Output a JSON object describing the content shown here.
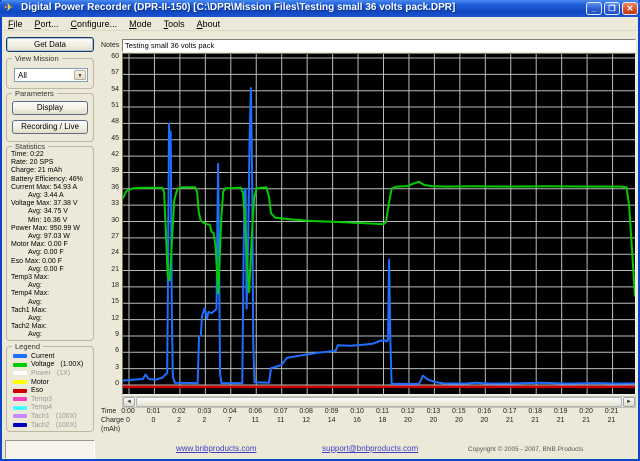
{
  "window": {
    "title": "Digital Power Recorder (DPR-II-150) [C:\\DPR\\Mission Files\\Testing small 36 volts pack.DPR]",
    "controls": {
      "minimize": "_",
      "maximize": "❐",
      "close": "✕"
    },
    "app_icon_glyph": "✈"
  },
  "menu": {
    "items": [
      "File",
      "Port...",
      "Configure...",
      "Mode",
      "Tools",
      "About"
    ]
  },
  "left_panel": {
    "get_data_label": "Get Data",
    "view_mission": {
      "title": "View Mission",
      "combo_value": "All",
      "combo_arrow": "▼"
    },
    "parameters": {
      "title": "Parameters",
      "display_label": "Display",
      "recording_label": "Recording / Live"
    },
    "statistics": {
      "title": "Statistics",
      "lines": [
        {
          "text": "Time: 0:22"
        },
        {
          "text": "Rate: 20 SPS"
        },
        {
          "text": "Charge: 21 mAh"
        },
        {
          "text": "Battery Efficiency: 46%"
        },
        {
          "text": "Current Max: 54.93 A"
        },
        {
          "text": "Avg: 3.44 A",
          "indent": true
        },
        {
          "text": "Voltage Max: 37.38 V"
        },
        {
          "text": "Avg: 34.75 V",
          "indent": true
        },
        {
          "text": "Min: 16.36 V",
          "indent": true
        },
        {
          "text": "Power Max: 950.99 W"
        },
        {
          "text": "Avg: 97.03 W",
          "indent": true
        },
        {
          "text": "Motor Max: 0.00 F"
        },
        {
          "text": "Avg: 0.00 F",
          "indent": true
        },
        {
          "text": "Eso Max: 0.00 F"
        },
        {
          "text": "Avg: 0.00 F",
          "indent": true
        },
        {
          "text": "Temp3 Max:"
        },
        {
          "text": "Avg:",
          "indent": true
        },
        {
          "text": "Temp4 Max:"
        },
        {
          "text": "Avg:",
          "indent": true
        },
        {
          "text": "Tach1 Max:"
        },
        {
          "text": "Avg:",
          "indent": true
        },
        {
          "text": "Tach2 Max:"
        },
        {
          "text": "Avg:",
          "indent": true
        }
      ]
    },
    "legend": {
      "title": "Legend",
      "items": [
        {
          "name": "Current",
          "mult": "",
          "color": "#1e6eff",
          "dim": false
        },
        {
          "name": "Voltage",
          "mult": "(1.00X)",
          "color": "#00cc00",
          "dim": false
        },
        {
          "name": "Power",
          "mult": "(1X)",
          "color": "#ffffff",
          "dim": true
        },
        {
          "name": "Motor",
          "mult": "",
          "color": "#ffff00",
          "dim": false
        },
        {
          "name": "Eso",
          "mult": "",
          "color": "#cc0000",
          "dim": false
        },
        {
          "name": "Temp3",
          "mult": "",
          "color": "#ee44bb",
          "dim": true
        },
        {
          "name": "Temp4",
          "mult": "",
          "color": "#44ffff",
          "dim": true
        },
        {
          "name": "Tach1",
          "mult": "(100X)",
          "color": "#cc88ff",
          "dim": true
        },
        {
          "name": "Tach2",
          "mult": "(100X)",
          "color": "#0000bb",
          "dim": true
        }
      ]
    }
  },
  "chart_panel": {
    "notes_label": "Notes",
    "notes_value": "Testing small 36 volts pack",
    "time_label": "Time",
    "charge_label": "Charge",
    "charge_unit": "(mAh)",
    "scroll_left_arrow": "◄",
    "scroll_right_arrow": "►"
  },
  "footer": {
    "link1": "www.bnbproducts.com",
    "link2": "support@bnbproducts.com",
    "copyright": "Copyright © 2005 - 2007, BNB Products"
  },
  "chart_data": {
    "type": "line",
    "title": "Testing small 36 volts pack",
    "background": "#000000",
    "grid_color": "#b6beb6",
    "grid": true,
    "y_axis": {
      "ticks": [
        60,
        57,
        54,
        51,
        48,
        45,
        42,
        39,
        36,
        33,
        30,
        27,
        24,
        21,
        18,
        15,
        12,
        9,
        6,
        3,
        0
      ],
      "min": -2,
      "max": 60.8
    },
    "x_axis": {
      "label": "Time",
      "tick_labels": [
        "0:00",
        "0:01",
        "0:02",
        "0:03",
        "0:04",
        "0:06",
        "0:07",
        "0:08",
        "0:09",
        "0:10",
        "0:11",
        "0:12",
        "0:13",
        "0:15",
        "0:16",
        "0:17",
        "0:18",
        "0:19",
        "0:20",
        "0:21"
      ],
      "secondary_label": "Charge",
      "secondary_unit": "(mAh)",
      "secondary_values": [
        "0",
        "0",
        "2",
        "2",
        "7",
        "11",
        "11",
        "12",
        "14",
        "16",
        "18",
        "20",
        "20",
        "20",
        "20",
        "21",
        "21",
        "21",
        "21",
        "21"
      ]
    },
    "series": [
      {
        "name": "Current",
        "unit": "A",
        "color": "#1e6eff",
        "width": 2,
        "points": [
          [
            -0.24,
            0.8
          ],
          [
            0.2,
            1.0
          ],
          [
            0.55,
            1.1
          ],
          [
            0.65,
            1.9
          ],
          [
            0.78,
            1.1
          ],
          [
            1.05,
            1.0
          ],
          [
            1.3,
            1.3
          ],
          [
            1.45,
            2.0
          ],
          [
            1.5,
            2.2
          ],
          [
            1.53,
            18
          ],
          [
            1.57,
            47.9
          ],
          [
            1.6,
            42
          ],
          [
            1.64,
            46.5
          ],
          [
            1.68,
            14
          ],
          [
            1.72,
            1.5
          ],
          [
            1.8,
            0.4
          ],
          [
            2.7,
            0.35
          ],
          [
            2.75,
            8.8
          ],
          [
            2.82,
            9.1
          ],
          [
            2.87,
            12.6
          ],
          [
            2.97,
            14.1
          ],
          [
            3.07,
            12.2
          ],
          [
            3.12,
            13.4
          ],
          [
            3.25,
            13.2
          ],
          [
            3.38,
            13.7
          ],
          [
            3.44,
            14.0
          ],
          [
            3.47,
            28
          ],
          [
            3.5,
            40.6
          ],
          [
            3.54,
            22
          ],
          [
            3.58,
            2
          ],
          [
            3.63,
            0.35
          ],
          [
            4.45,
            0.35
          ],
          [
            4.5,
            22
          ],
          [
            4.54,
            35.5
          ],
          [
            4.58,
            36
          ],
          [
            4.62,
            14
          ],
          [
            4.68,
            26
          ],
          [
            4.74,
            45
          ],
          [
            4.79,
            54.5
          ],
          [
            4.84,
            37
          ],
          [
            4.88,
            8
          ],
          [
            4.93,
            0.5
          ],
          [
            5.5,
            0.4
          ],
          [
            5.58,
            3.1
          ],
          [
            5.75,
            3.3
          ],
          [
            6.0,
            3.7
          ],
          [
            6.2,
            5.0
          ],
          [
            6.6,
            5.3
          ],
          [
            7.0,
            5.6
          ],
          [
            7.4,
            5.9
          ],
          [
            7.8,
            6.1
          ],
          [
            8.12,
            6.3
          ],
          [
            8.2,
            7.3
          ],
          [
            8.7,
            7.2
          ],
          [
            9.2,
            7.4
          ],
          [
            9.6,
            7.6
          ],
          [
            9.85,
            8.1
          ],
          [
            10.05,
            8.2
          ],
          [
            10.12,
            8.0
          ],
          [
            10.18,
            8.3
          ],
          [
            10.22,
            23
          ],
          [
            10.27,
            8
          ],
          [
            10.32,
            0.2
          ],
          [
            11.4,
            0.2
          ],
          [
            11.55,
            1.7
          ],
          [
            11.75,
            1.0
          ],
          [
            12.05,
            0.5
          ],
          [
            12.35,
            0.3
          ],
          [
            13.2,
            0.25
          ],
          [
            13.6,
            0.4
          ],
          [
            14.2,
            0.25
          ],
          [
            15.2,
            0.3
          ],
          [
            16.2,
            0.4
          ],
          [
            17.2,
            0.25
          ],
          [
            18.3,
            0.35
          ],
          [
            19.2,
            0.25
          ],
          [
            19.88,
            0.3
          ]
        ]
      },
      {
        "name": "Voltage",
        "unit": "V",
        "color": "#00cc00",
        "width": 2,
        "points": [
          [
            -0.24,
            34.3
          ],
          [
            -0.1,
            35.6
          ],
          [
            0.15,
            36.1
          ],
          [
            0.6,
            36.2
          ],
          [
            1.3,
            36.2
          ],
          [
            1.38,
            35.4
          ],
          [
            1.45,
            28
          ],
          [
            1.52,
            20
          ],
          [
            1.6,
            19.2
          ],
          [
            1.68,
            26
          ],
          [
            1.78,
            34
          ],
          [
            1.9,
            36.0
          ],
          [
            2.1,
            36.3
          ],
          [
            2.6,
            36.3
          ],
          [
            2.68,
            35.3
          ],
          [
            2.74,
            31.8
          ],
          [
            2.82,
            30.1
          ],
          [
            3.0,
            29.6
          ],
          [
            3.18,
            29.4
          ],
          [
            3.24,
            28.1
          ],
          [
            3.32,
            27.9
          ],
          [
            3.4,
            25.5
          ],
          [
            3.46,
            20.5
          ],
          [
            3.51,
            16.8
          ],
          [
            3.57,
            24
          ],
          [
            3.63,
            31
          ],
          [
            3.7,
            35.5
          ],
          [
            3.8,
            36.1
          ],
          [
            4.4,
            36.2
          ],
          [
            4.48,
            35.2
          ],
          [
            4.56,
            30
          ],
          [
            4.65,
            22
          ],
          [
            4.72,
            17
          ],
          [
            4.82,
            27
          ],
          [
            4.92,
            34.5
          ],
          [
            5.02,
            36.1
          ],
          [
            5.4,
            36.3
          ],
          [
            5.5,
            34.5
          ],
          [
            5.58,
            31.5
          ],
          [
            5.75,
            30.7
          ],
          [
            6.3,
            30.4
          ],
          [
            7.2,
            30.1
          ],
          [
            8.2,
            29.9
          ],
          [
            9.2,
            29.7
          ],
          [
            10.0,
            29.5
          ],
          [
            10.1,
            29.9
          ],
          [
            10.2,
            33
          ],
          [
            10.32,
            36.0
          ],
          [
            10.5,
            36.4
          ],
          [
            10.95,
            36.5
          ],
          [
            11.2,
            37.0
          ],
          [
            11.4,
            37.3
          ],
          [
            11.6,
            36.7
          ],
          [
            11.9,
            36.5
          ],
          [
            12.5,
            36.4
          ],
          [
            13.5,
            36.45
          ],
          [
            15,
            36.4
          ],
          [
            16.5,
            36.45
          ],
          [
            18,
            36.4
          ],
          [
            19.3,
            36.4
          ],
          [
            19.55,
            36.3
          ],
          [
            19.65,
            33
          ],
          [
            19.75,
            26
          ],
          [
            19.88,
            16.4
          ]
        ]
      },
      {
        "name": "Eso",
        "unit": "",
        "color": "#cc0000",
        "width": 2.5,
        "points": [
          [
            -0.24,
            -0.35
          ],
          [
            19.88,
            -0.35
          ]
        ]
      }
    ]
  }
}
